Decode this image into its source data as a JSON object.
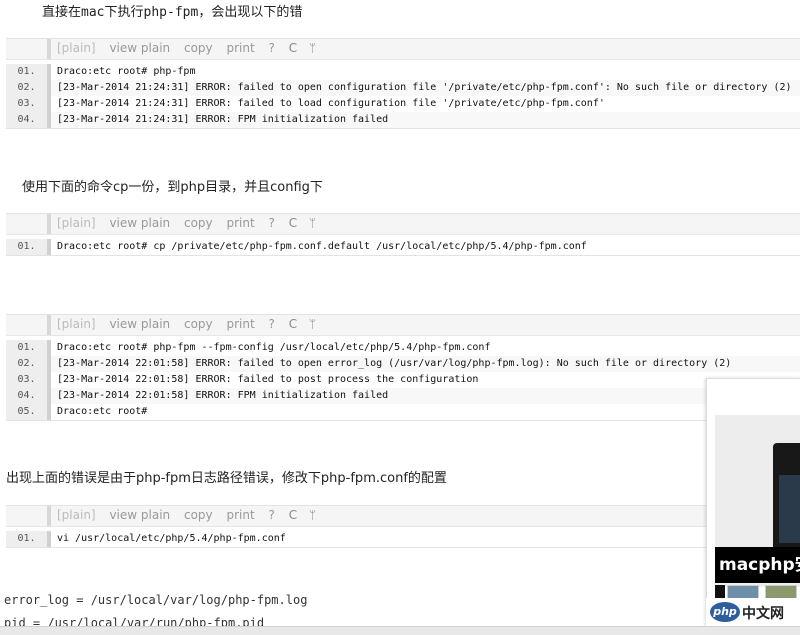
{
  "paragraphs": {
    "p1_a": "直接在",
    "p1_mac": "mac",
    "p1_b": "下执行",
    "p1_cmd": "php-fpm",
    "p1_c": "，会出现以下的错",
    "p2": "使用下面的命令cp一份，到php目录，并且config下",
    "p3": "出现上面的错误是由于php-fpm日志路径错误，修改下php-fpm.conf的配置"
  },
  "toolbar": {
    "plain": "[plain]",
    "view_plain": "view plain",
    "copy": "copy",
    "print": "print",
    "help": "?",
    "icon1": "C",
    "icon2": "ᛘ"
  },
  "code_blocks": [
    {
      "lines": [
        {
          "num": "01.",
          "text": "Draco:etc root# php-fpm"
        },
        {
          "num": "02.",
          "text": "[23-Mar-2014 21:24:31] ERROR: failed to open configuration file '/private/etc/php-fpm.conf': No such file or directory (2)"
        },
        {
          "num": "03.",
          "text": "[23-Mar-2014 21:24:31] ERROR: failed to load configuration file '/private/etc/php-fpm.conf'"
        },
        {
          "num": "04.",
          "text": "[23-Mar-2014 21:24:31] ERROR: FPM initialization failed"
        }
      ]
    },
    {
      "lines": [
        {
          "num": "01.",
          "text": "Draco:etc root# cp /private/etc/php-fpm.conf.default /usr/local/etc/php/5.4/php-fpm.conf"
        }
      ]
    },
    {
      "lines": [
        {
          "num": "01.",
          "text": "Draco:etc root# php-fpm --fpm-config /usr/local/etc/php/5.4/php-fpm.conf"
        },
        {
          "num": "02.",
          "text": "[23-Mar-2014 22:01:58] ERROR: failed to open error_log (/usr/var/log/php-fpm.log): No such file or directory (2)"
        },
        {
          "num": "03.",
          "text": "[23-Mar-2014 22:01:58] ERROR: failed to post process the configuration"
        },
        {
          "num": "04.",
          "text": "[23-Mar-2014 22:01:58] ERROR: FPM initialization failed"
        },
        {
          "num": "05.",
          "text": "Draco:etc root#"
        }
      ]
    },
    {
      "lines": [
        {
          "num": "01.",
          "text": "vi /usr/local/etc/php/5.4/php-fpm.conf"
        }
      ]
    }
  ],
  "config": {
    "line1": "error_log = /usr/local/var/log/php-fpm.log",
    "line2": "pid = /usr/local/var/run/php-fpm.pid"
  },
  "ad": {
    "banner": "macphp安",
    "logo_php": "php",
    "logo_cn": "中文网"
  }
}
